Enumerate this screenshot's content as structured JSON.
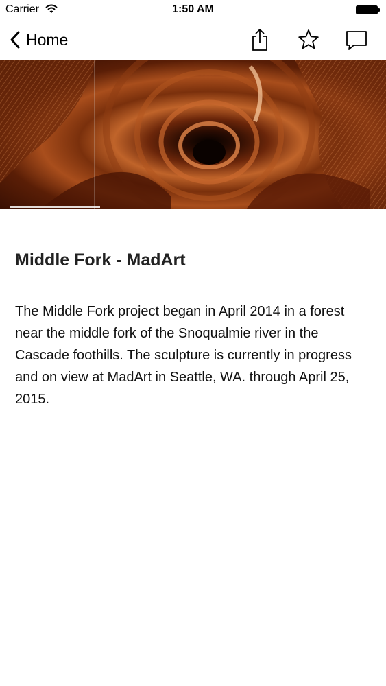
{
  "status_bar": {
    "carrier": "Carrier",
    "time": "1:50 AM"
  },
  "nav": {
    "back_label": "Home",
    "icons": [
      "chevron-left-icon",
      "share-icon",
      "star-icon",
      "comment-icon"
    ]
  },
  "hero": {
    "icon": "sculpture-photo",
    "colors": {
      "dark": "#2a0c02",
      "mid": "#8a3810",
      "light": "#d97a3c"
    }
  },
  "article": {
    "title": "Middle Fork - MadArt",
    "body": "The Middle Fork project began in April 2014 in a forest near the middle fork of the Snoqualmie river in the Cascade foothills. The sculpture is currently in progress and on view at MadArt in Seattle, WA. through April 25, 2015."
  }
}
